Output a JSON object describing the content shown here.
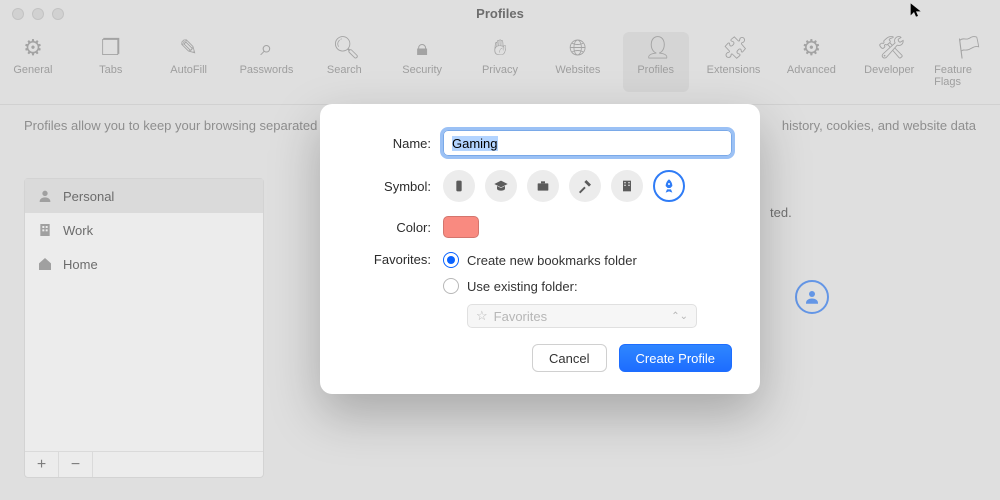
{
  "window": {
    "title": "Profiles"
  },
  "toolbar": {
    "items": [
      {
        "label": "General",
        "icon": "gear-icon"
      },
      {
        "label": "Tabs",
        "icon": "tabs-icon"
      },
      {
        "label": "AutoFill",
        "icon": "autofill-icon"
      },
      {
        "label": "Passwords",
        "icon": "key-icon"
      },
      {
        "label": "Search",
        "icon": "search-icon"
      },
      {
        "label": "Security",
        "icon": "lock-icon"
      },
      {
        "label": "Privacy",
        "icon": "hand-icon"
      },
      {
        "label": "Websites",
        "icon": "globe-icon"
      },
      {
        "label": "Profiles",
        "icon": "person-icon",
        "active": true
      },
      {
        "label": "Extensions",
        "icon": "puzzle-icon"
      },
      {
        "label": "Advanced",
        "icon": "gears-icon"
      },
      {
        "label": "Developer",
        "icon": "tools-icon"
      },
      {
        "label": "Feature Flags",
        "icon": "flags-icon"
      }
    ]
  },
  "description": "Profiles allow you to keep your browsing separated per profile.",
  "description_tail": "history, cookies, and website data",
  "sidebar": {
    "items": [
      {
        "label": "Personal",
        "icon": "person-icon",
        "selected": true
      },
      {
        "label": "Work",
        "icon": "building-icon"
      },
      {
        "label": "Home",
        "icon": "house-icon"
      }
    ],
    "add_label": "+",
    "remove_label": "−"
  },
  "right": {
    "info_tail": "ted.",
    "person_icon": "person-icon"
  },
  "modal": {
    "name_label": "Name:",
    "name_value": "Gaming",
    "symbol_label": "Symbol:",
    "symbols": [
      {
        "name": "badge-icon"
      },
      {
        "name": "grad-cap-icon"
      },
      {
        "name": "briefcase-icon"
      },
      {
        "name": "hammer-icon"
      },
      {
        "name": "building-icon"
      },
      {
        "name": "rocket-icon",
        "selected": true
      }
    ],
    "color_label": "Color:",
    "color_value": "#f98a80",
    "favorites_label": "Favorites:",
    "fav_option_new": "Create new bookmarks folder",
    "fav_option_existing": "Use existing folder:",
    "fav_selected": "new",
    "folder_select_value": "Favorites",
    "cancel_label": "Cancel",
    "create_label": "Create Profile"
  }
}
